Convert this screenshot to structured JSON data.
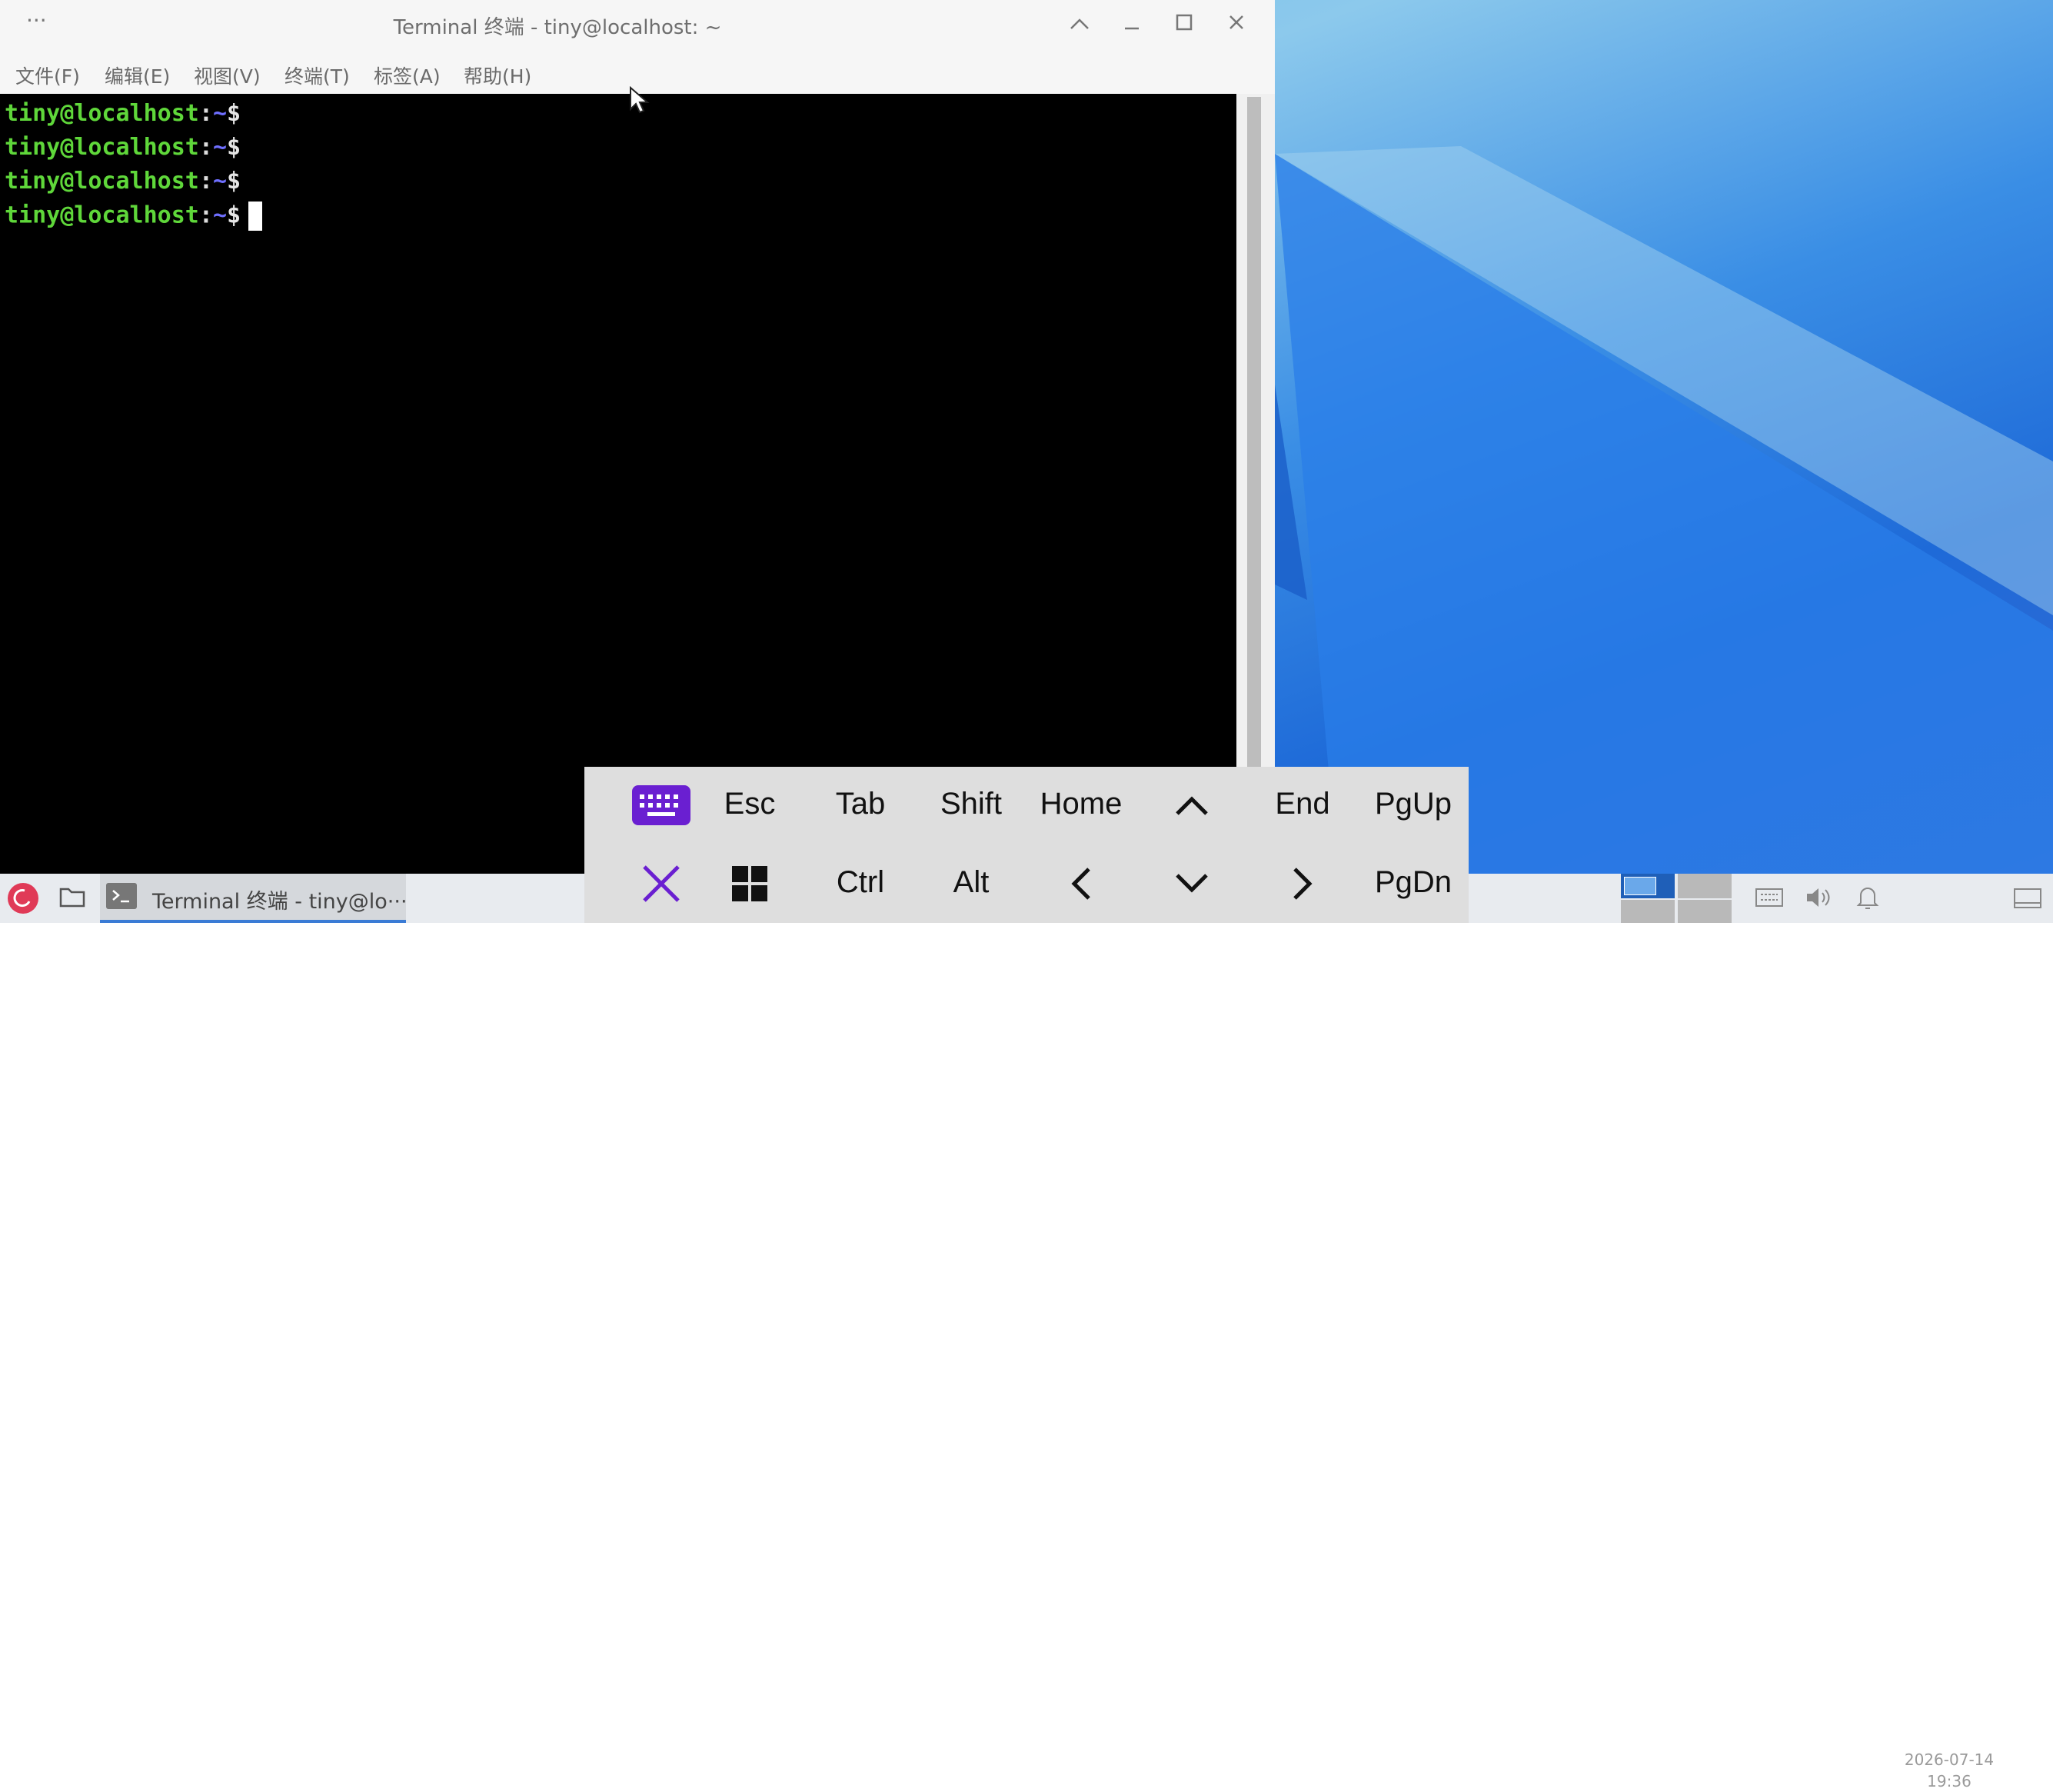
{
  "window": {
    "title": "Terminal 终端 - tiny@localhost: ~",
    "menu": [
      "文件(F)",
      "编辑(E)",
      "视图(V)",
      "终端(T)",
      "标签(A)",
      "帮助(H)"
    ]
  },
  "terminal": {
    "prompt_user": "tiny@localhost",
    "prompt_colon": ":",
    "prompt_path": "~",
    "prompt_symbol": "$",
    "line_count": 4
  },
  "keybar": {
    "row1": [
      "Esc",
      "Tab",
      "Shift",
      "Home",
      "End",
      "PgUp"
    ],
    "row2": [
      "Ctrl",
      "Alt",
      "PgDn"
    ]
  },
  "taskbar": {
    "task_label": "Terminal 终端 - tiny@lo···",
    "date": "2026-07-14",
    "time": "19:36"
  },
  "colors": {
    "prompt_user": "#5fd73a",
    "prompt_path": "#6f6fff",
    "terminal_bg": "#000000",
    "keyboard_icon": "#6a1fd1",
    "close_x": "#6a1fd1",
    "debian_logo": "#e03a57"
  }
}
